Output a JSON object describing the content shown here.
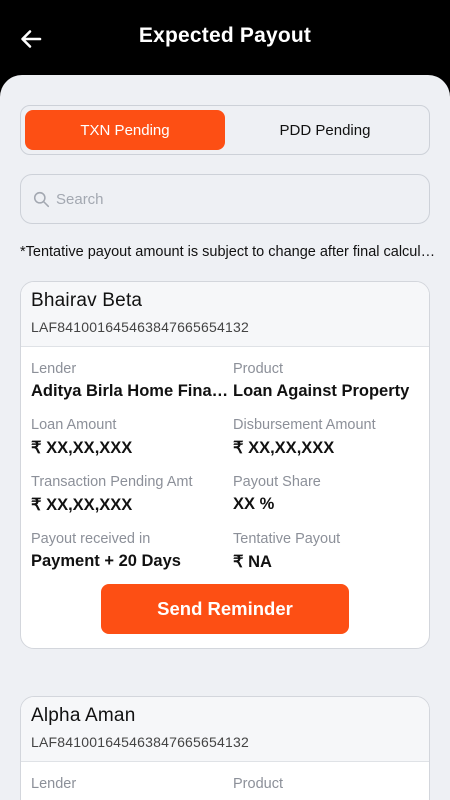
{
  "header": {
    "title": "Expected Payout"
  },
  "tabs": [
    {
      "label": "TXN Pending",
      "active": true
    },
    {
      "label": "PDD Pending",
      "active": false
    }
  ],
  "search": {
    "placeholder": "Search"
  },
  "disclaimer": "*Tentative payout amount is subject to change after final calculation",
  "cards": [
    {
      "name": "Bhairav Beta",
      "id": "LAF841001645463847665654132",
      "lender_label": "Lender",
      "lender": "Aditya Birla Home Finance",
      "product_label": "Product",
      "product": "Loan Against Property",
      "loan_amount_label": "Loan Amount",
      "loan_amount": "₹ XX,XX,XXX",
      "disbursement_label": "Disbursement Amount",
      "disbursement": "₹ XX,XX,XXX",
      "txn_pending_label": "Transaction Pending Amt",
      "txn_pending": "₹ XX,XX,XXX",
      "payout_share_label": "Payout Share",
      "payout_share": "XX %",
      "payout_received_label": "Payout received in",
      "payout_received": "Payment  + 20 Days",
      "tentative_label": "Tentative Payout",
      "tentative": "₹ NA",
      "button_label": "Send Reminder"
    },
    {
      "name": "Alpha Aman",
      "id": "LAF841001645463847665654132",
      "lender_label": "Lender",
      "product_label": "Product"
    }
  ],
  "colors": {
    "accent": "#fd4f14",
    "header_bg": "#000000",
    "sheet_bg": "#eef0f4"
  }
}
